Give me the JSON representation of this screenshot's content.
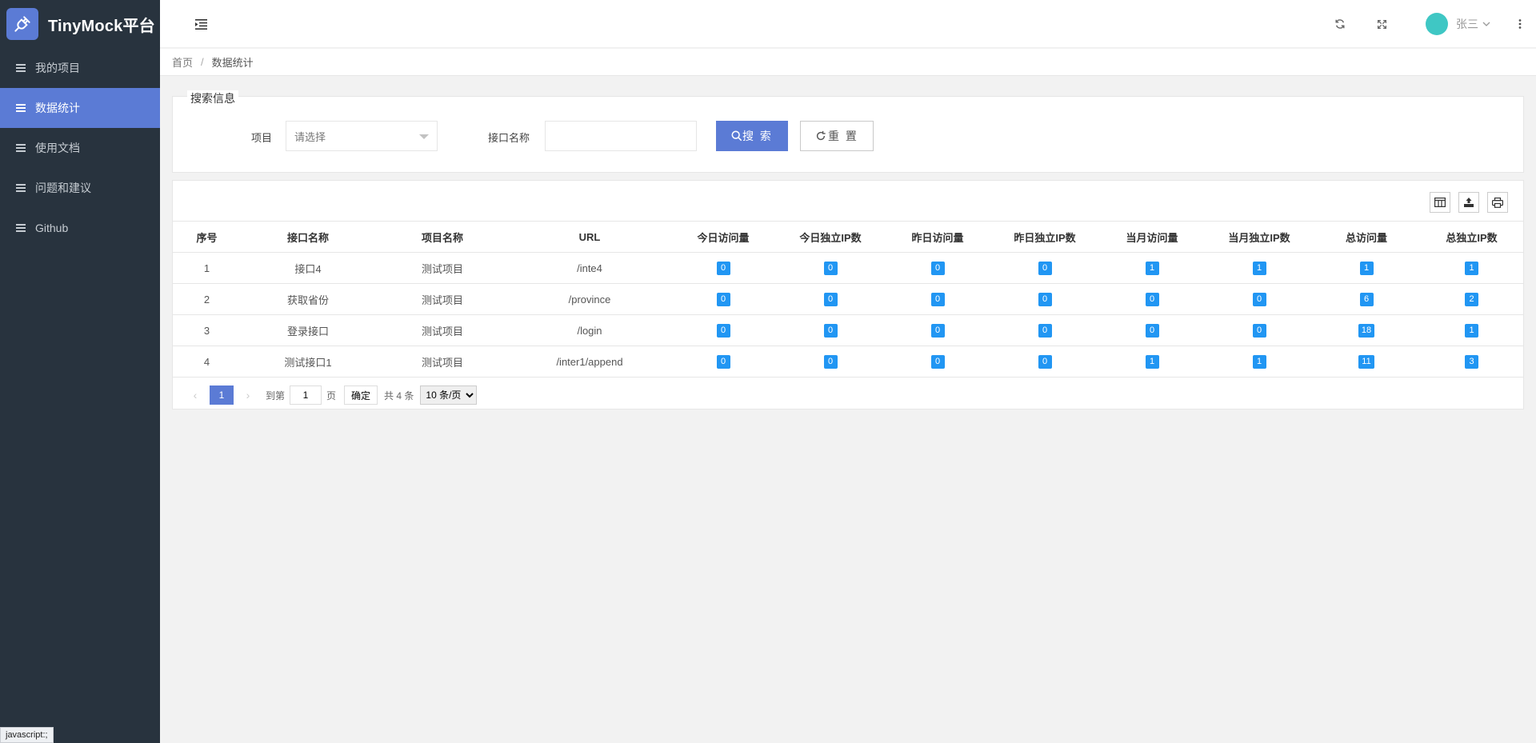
{
  "app": {
    "title": "TinyMock平台",
    "logo_icon": "plug-icon",
    "brand_color": "#5b7bd5",
    "sidebar_color": "#28333e"
  },
  "sidebar": {
    "items": [
      {
        "label": "我的项目",
        "active": false
      },
      {
        "label": "数据统计",
        "active": true
      },
      {
        "label": "使用文档",
        "active": false
      },
      {
        "label": "问题和建议",
        "active": false
      },
      {
        "label": "Github",
        "active": false
      }
    ]
  },
  "header": {
    "menu_toggle_icon": "indent-icon",
    "refresh_icon": "refresh-icon",
    "fullscreen_icon": "fullscreen-icon",
    "user_name": "张三",
    "more_icon": "more-vertical-icon"
  },
  "breadcrumb": {
    "home": "首页",
    "separator": "/",
    "current": "数据统计"
  },
  "search": {
    "legend": "搜索信息",
    "project_label": "项目",
    "project_placeholder": "请选择",
    "api_name_label": "接口名称",
    "api_name_value": "",
    "search_button": "搜 索",
    "reset_button": "重 置"
  },
  "table": {
    "toolbar": [
      "columns-icon",
      "export-icon",
      "print-icon"
    ],
    "columns": [
      "序号",
      "接口名称",
      "项目名称",
      "URL",
      "今日访问量",
      "今日独立IP数",
      "昨日访问量",
      "昨日独立IP数",
      "当月访问量",
      "当月独立IP数",
      "总访问量",
      "总独立IP数"
    ],
    "rows": [
      {
        "no": "1",
        "name": "接口4",
        "project": "测试项目",
        "url": "/inte4",
        "stats": [
          "0",
          "0",
          "0",
          "0",
          "1",
          "1",
          "1",
          "1"
        ]
      },
      {
        "no": "2",
        "name": "获取省份",
        "project": "测试项目",
        "url": "/province",
        "stats": [
          "0",
          "0",
          "0",
          "0",
          "0",
          "0",
          "6",
          "2"
        ]
      },
      {
        "no": "3",
        "name": "登录接口",
        "project": "测试项目",
        "url": "/login",
        "stats": [
          "0",
          "0",
          "0",
          "0",
          "0",
          "0",
          "18",
          "1"
        ]
      },
      {
        "no": "4",
        "name": "测试接口1",
        "project": "测试项目",
        "url": "/inter1/append",
        "stats": [
          "0",
          "0",
          "0",
          "0",
          "1",
          "1",
          "11",
          "3"
        ]
      }
    ],
    "badge_color": "#2196f3"
  },
  "pager": {
    "current": "1",
    "goto_label": "到第",
    "goto_value": "1",
    "page_suffix": "页",
    "confirm": "确定",
    "total": "共 4 条",
    "page_size": "10 条/页",
    "page_size_options": [
      "10 条/页"
    ]
  },
  "status_bar": "javascript:;"
}
